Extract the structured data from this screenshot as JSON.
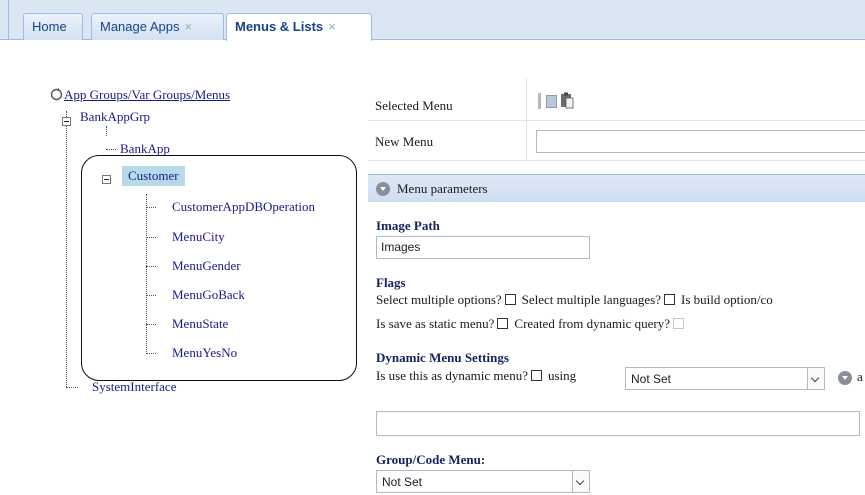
{
  "tabs": [
    {
      "label": "Home",
      "closable": false
    },
    {
      "label": "Manage Apps",
      "closable": true
    },
    {
      "label": "Menus & Lists",
      "closable": true,
      "active": true
    }
  ],
  "tab_close_glyph": "×",
  "tree": {
    "root_label": "App Groups/Var Groups/Menus",
    "root_icon": "refresh-icon",
    "group": "BankAppGrp",
    "app": "BankApp",
    "selected_node": "Customer",
    "customer_children": [
      "CustomerAppDBOperation",
      "MenuCity",
      "MenuGender",
      "MenuGoBack",
      "MenuState",
      "MenuYesNo"
    ],
    "last_node": "SystemInterface"
  },
  "panel": {
    "selected_menu_label": "Selected Menu",
    "new_menu_label": "New Menu",
    "new_menu_value": "",
    "section_header": "Menu parameters",
    "image_path_label": "Image Path",
    "image_path_value": "Images",
    "flags_label": "Flags",
    "flag_select_multiple_options": "Select multiple options?",
    "flag_select_multiple_languages": "Select multiple languages?",
    "flag_is_build_option": "Is build option/co",
    "flag_save_static": "Is save as static menu?",
    "flag_created_dynamic": "Created from dynamic query?",
    "dynamic_settings_label": "Dynamic Menu Settings",
    "dynamic_use_label": "Is use this as dynamic menu?",
    "dynamic_using_label": "using",
    "dynamic_select_value": "Not Set",
    "dynamic_trailing": "a",
    "dynamic_query_value": "",
    "group_code_label": "Group/Code Menu:",
    "group_code_value": "Not Set"
  },
  "colors": {
    "tab_border": "#99bbe8",
    "tab_text": "#15428b",
    "tree_link": "#1a1a8c",
    "selected_bg": "#b6dbe8",
    "section_title": "#15225e"
  }
}
